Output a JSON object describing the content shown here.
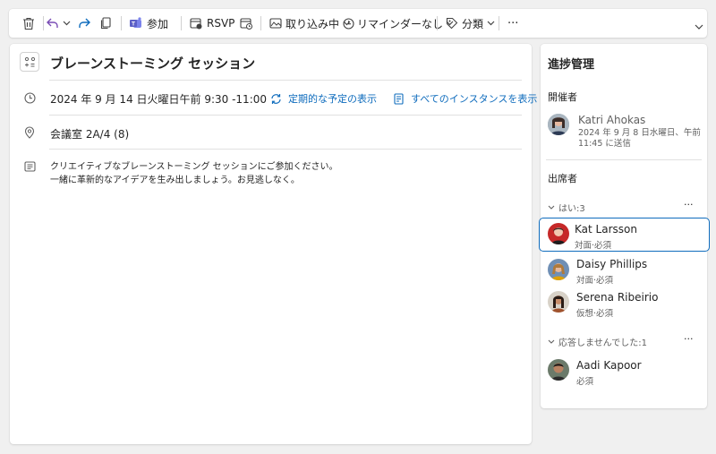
{
  "toolbar": {
    "join_label": "参加",
    "rsvp_label": "RSVP",
    "show_as_label": "取り込み中",
    "reminder_label": "リマインダーなし",
    "category_label": "分類",
    "more_label": "···"
  },
  "event": {
    "title": "ブレーンストーミング セッション",
    "datetime": "2024 年 9 月 14 日火曜日午前 9:30 -11:00",
    "recurring_link": "定期的な予定の表示",
    "instances_link": "すべてのインスタンスを表示",
    "location": "会議室 2A/4 (8)",
    "description_line1": "クリエイティブなブレーンストーミング セッションにご参加ください。",
    "description_line2": "一緒に革新的なアイデアを生み出しましょう。お見逃しなく。"
  },
  "tracking": {
    "title": "進捗管理",
    "organizer_heading": "開催者",
    "organizer": {
      "name": "Katri Ahokas",
      "sent_line1": "2024 年 9 月 8 日水曜日、午前",
      "sent_line2": "11:45 に送信"
    },
    "attendees_heading": "出席者",
    "yes_group": "はい:3",
    "no_response_group": "応答しませんでした:1",
    "group_more": "···",
    "yes_attendees": [
      {
        "name": "Kat Larsson",
        "detail": "対面·必須"
      },
      {
        "name": "Daisy Phillips",
        "detail": "対面·必須"
      },
      {
        "name": "Serena Ribeirio",
        "detail": "仮想·必須"
      }
    ],
    "no_response_attendees": [
      {
        "name": "Aadi Kapoor",
        "detail": "必須"
      }
    ]
  },
  "colors": {
    "accent": "#0f6cbd",
    "undo": "#7a4db5",
    "teams": "#5b5fc7",
    "selection_border": "#0f6cbd"
  }
}
